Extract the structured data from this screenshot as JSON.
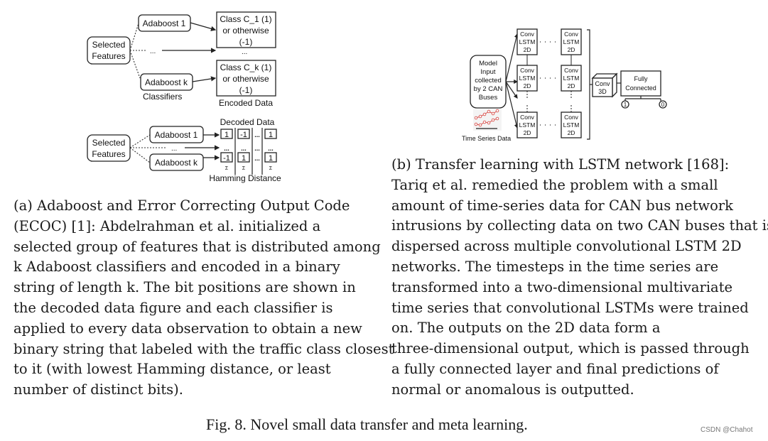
{
  "figure_a": {
    "top": {
      "selected_features": [
        "Selected",
        "Features"
      ],
      "classifier_1": "Adaboost 1",
      "classifier_k": "Adaboost k",
      "ellipsis": "...",
      "classifiers_label": "Classifiers",
      "class_1": [
        "Class C_1 (1)",
        "or otherwise",
        "(-1)"
      ],
      "class_k": [
        "Class C_k (1)",
        "or otherwise",
        "(-1)"
      ],
      "encoded_label": "Encoded Data"
    },
    "bottom": {
      "selected_features": [
        "Selected",
        "Features"
      ],
      "classifier_1": "Adaboost 1",
      "classifier_k": "Adaboost k",
      "ellipsis": "...",
      "decoded_label": "Decoded Data",
      "hamming_label": "Hamming Distance",
      "row_1": [
        "1",
        "-1",
        "...",
        "1"
      ],
      "row_mid": [
        "...",
        "...",
        "...",
        "..."
      ],
      "row_k": [
        "-1",
        "1",
        "...",
        "1"
      ],
      "sigma": "Σ"
    }
  },
  "figure_b": {
    "model_input": [
      "Model",
      "Input",
      "collected",
      "by 2 CAN",
      "Buses"
    ],
    "time_series_label": "Time Series Data",
    "convlstm": [
      "Conv",
      "LSTM",
      "2D"
    ],
    "conv3d": [
      "Conv",
      "3D"
    ],
    "fully_connected": [
      "Fully",
      "Connected"
    ],
    "output_1": "1",
    "output_0": "0",
    "accent_color": "#d9534f"
  },
  "caption_a": [
    "(a) Adaboost and Error Correcting Output Code",
    "(ECOC) [1]: Abdelrahman et al. initialized a",
    "selected group of features that is distributed among",
    "k Adaboost classifiers and encoded in a binary",
    "string of length k. The bit positions are shown in",
    "the decoded data figure and each classifier is",
    "applied to every data observation to obtain a new",
    "binary string that labeled with the traffic class closest",
    "to it (with lowest Hamming distance, or least",
    "number of distinct bits)."
  ],
  "caption_b": [
    "(b) Transfer learning with LSTM network [168]:",
    "Tariq et al. remedied the problem with a small",
    "amount of time-series data for CAN bus network",
    "intrusions by collecting data on two CAN buses that is",
    "dispersed across multiple convolutional LSTM 2D",
    "networks. The timesteps in the time series are",
    "transformed into a two-dimensional multivariate",
    "time series that convolutional LSTMs were trained",
    "on. The outputs on the 2D data form a",
    "three-dimensional output, which is passed through",
    "a fully connected layer and final predictions of",
    "normal or anomalous is outputted."
  ],
  "figure_title": "Fig. 8.  Novel small data transfer and meta learning.",
  "watermark": "CSDN @Chahot"
}
